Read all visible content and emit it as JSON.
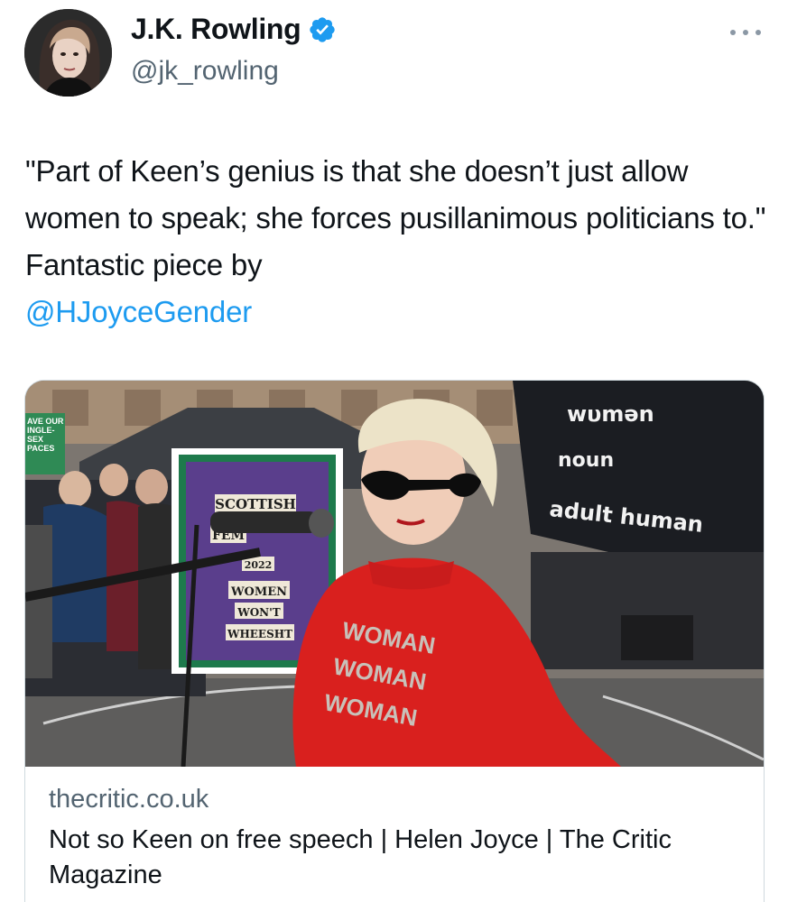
{
  "author": {
    "display_name": "J.K. Rowling",
    "handle": "@jk_rowling",
    "verified_icon": "verified-badge-icon",
    "avatar_icon": "avatar"
  },
  "tweet": {
    "text_before": "\"Part of Keen’s genius is that she doesn’t just allow women to speak; she forces pusillanimous politicians to.\" Fantastic piece by ",
    "mention": "@HJoyceGender"
  },
  "link_card": {
    "domain": "thecritic.co.uk",
    "title": "Not so Keen on free speech | Helen Joyce | The Critic Magazine",
    "image": {
      "banner_lines": [
        "wυmən",
        "noun",
        "adult human"
      ],
      "sign_lines": [
        "SCOTTISH",
        "FEM",
        "2022",
        "WOMEN",
        "WON'T",
        "WHEESHT"
      ],
      "shirt_lines": [
        "WOMAN",
        "WOMAN",
        "WOMAN"
      ],
      "placard_lines": [
        "AVE OUR",
        "INGLE-",
        "SEX",
        "PACES"
      ]
    }
  },
  "colors": {
    "link": "#1d9bf0",
    "secondary_text": "#536471",
    "border": "#cfd9de",
    "verified": "#1d9bf0"
  }
}
